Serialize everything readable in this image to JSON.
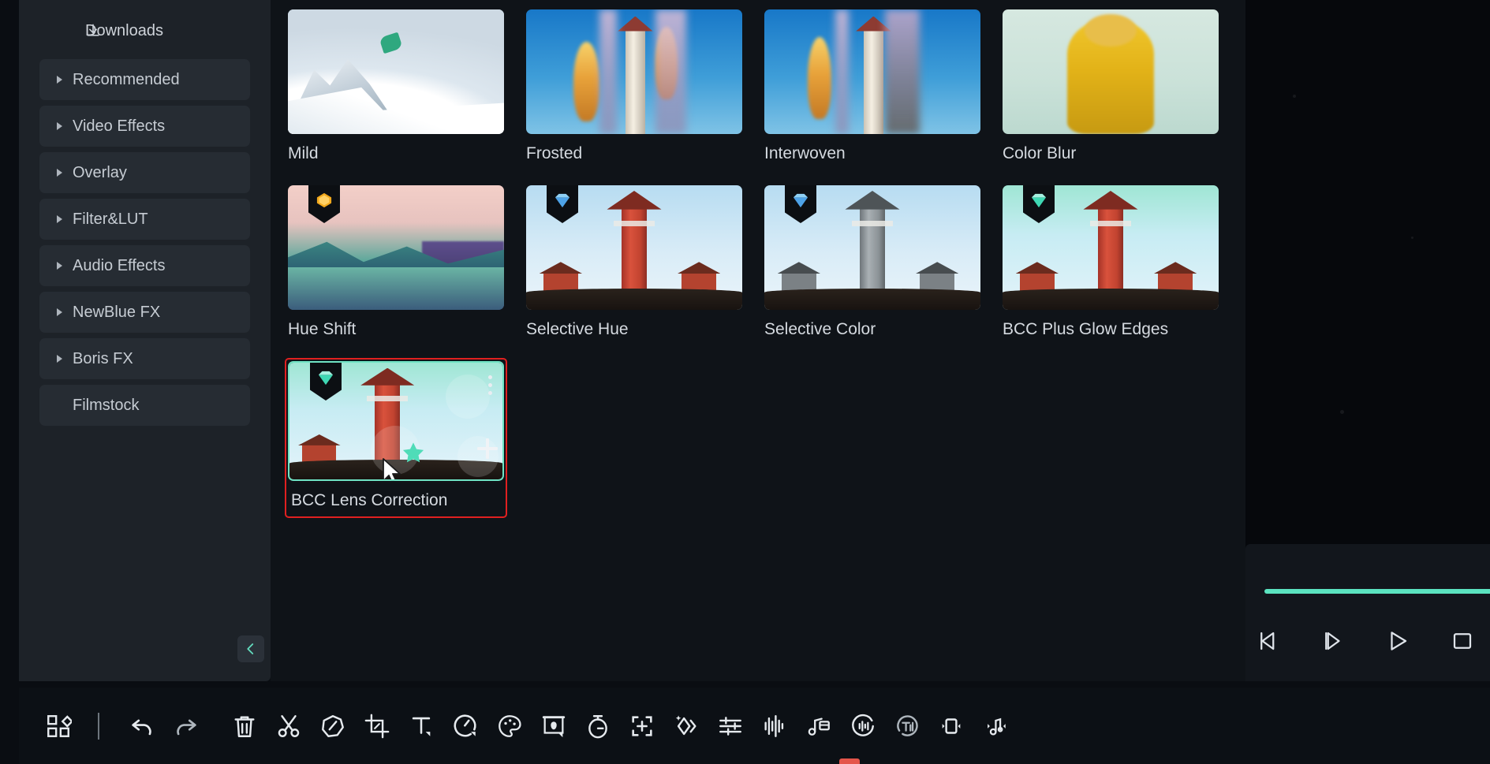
{
  "sidebar": {
    "downloads": {
      "label": "Downloads",
      "icon": "download-icon"
    },
    "items": [
      {
        "label": "Recommended",
        "expandable": true
      },
      {
        "label": "Video Effects",
        "expandable": true
      },
      {
        "label": "Overlay",
        "expandable": true
      },
      {
        "label": "Filter&LUT",
        "expandable": true
      },
      {
        "label": "Audio Effects",
        "expandable": true
      },
      {
        "label": "NewBlue FX",
        "expandable": true
      },
      {
        "label": "Boris FX",
        "expandable": true
      },
      {
        "label": "Filmstock",
        "expandable": false
      }
    ],
    "collapse": {
      "icon": "chevron-left-icon"
    }
  },
  "effects": {
    "accent_selected": "#e02020",
    "accent_teal": "#6fe3c4",
    "items": [
      {
        "label": "Mild",
        "badge": null,
        "art": "snow",
        "selected": false
      },
      {
        "label": "Frosted",
        "badge": null,
        "art": "frosted",
        "selected": false
      },
      {
        "label": "Interwoven",
        "badge": null,
        "art": "interwoven",
        "selected": false
      },
      {
        "label": "Color Blur",
        "badge": null,
        "art": "monk",
        "selected": false
      },
      {
        "label": "Hue Shift",
        "badge": "gem-gold",
        "art": "hue",
        "selected": false
      },
      {
        "label": "Selective Hue",
        "badge": "gem-blue",
        "art": "lighthouse-red",
        "selected": false
      },
      {
        "label": "Selective Color",
        "badge": "gem-blue",
        "art": "lighthouse-grey",
        "selected": false
      },
      {
        "label": "BCC Plus Glow Edges",
        "badge": "gem-teal",
        "art": "lighthouse-red-pale",
        "selected": false
      },
      {
        "label": "BCC Lens Correction",
        "badge": "gem-teal",
        "art": "lighthouse-red-pale",
        "selected": true
      }
    ],
    "overlay": {
      "menu_icon": "three-dots-icon",
      "add_icon": "plus-icon",
      "favorite_icon": "star-icon"
    }
  },
  "preview": {
    "progress_color": "#5be3c0",
    "controls": [
      {
        "name": "previous-frame-button",
        "icon": "step-backward-icon"
      },
      {
        "name": "next-frame-button",
        "icon": "step-forward-icon"
      },
      {
        "name": "play-button",
        "icon": "play-icon"
      },
      {
        "name": "stop-button",
        "icon": "stop-icon"
      }
    ]
  },
  "toolbar": {
    "buttons": [
      {
        "name": "layout-grid-button",
        "icon": "grid-layout-icon"
      },
      {
        "name": "undo-button",
        "icon": "undo-arrow-icon"
      },
      {
        "name": "redo-button",
        "icon": "redo-arrow-icon"
      },
      {
        "name": "delete-button",
        "icon": "trash-icon"
      },
      {
        "name": "split-button",
        "icon": "scissors-icon"
      },
      {
        "name": "marker-button",
        "icon": "tag-icon"
      },
      {
        "name": "crop-button",
        "icon": "crop-icon"
      },
      {
        "name": "text-button",
        "icon": "text-t-icon"
      },
      {
        "name": "speed-button",
        "icon": "speed-gauge-icon"
      },
      {
        "name": "color-button",
        "icon": "palette-icon"
      },
      {
        "name": "green-screen-button",
        "icon": "green-screen-icon"
      },
      {
        "name": "duration-button",
        "icon": "stopwatch-icon"
      },
      {
        "name": "auto-reframe-button",
        "icon": "reframe-plus-icon"
      },
      {
        "name": "ai-effects-button",
        "icon": "sparkle-diamond-icon"
      },
      {
        "name": "adjust-button",
        "icon": "sliders-icon"
      },
      {
        "name": "audio-waveform-button",
        "icon": "waveform-icon"
      },
      {
        "name": "audio-detach-button",
        "icon": "music-detach-icon"
      },
      {
        "name": "audio-denoise-button",
        "icon": "audio-circle-icon"
      },
      {
        "name": "auto-caption-button",
        "icon": "caption-circle-icon"
      },
      {
        "name": "freeze-frame-button",
        "icon": "freeze-frame-icon"
      },
      {
        "name": "audio-stretch-button",
        "icon": "music-stretch-icon"
      }
    ]
  }
}
